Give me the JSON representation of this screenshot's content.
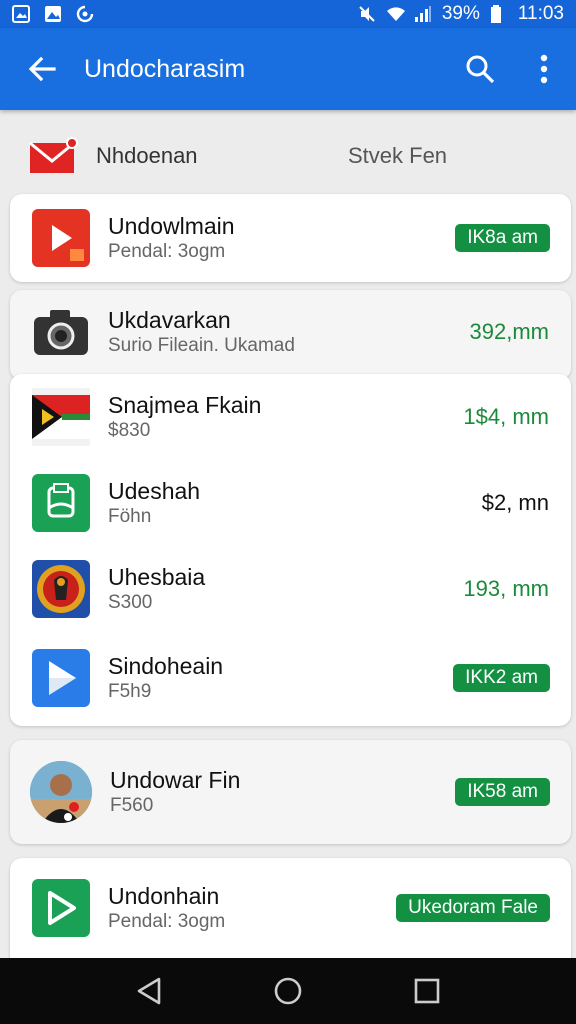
{
  "status_bar": {
    "battery": "39%",
    "time": "11:03"
  },
  "app_bar": {
    "title": "Undocharasim"
  },
  "header": {
    "name": "Nhdoenan",
    "right": "Stvek Fen"
  },
  "items": [
    {
      "name": "Undowlmain",
      "sub": "Pendal: 3ogm",
      "price": "IK8a am",
      "price_style": "badge",
      "icon": "youtube-icon"
    },
    {
      "name": "Ukdavarkan",
      "sub": "Surio Fileain. Ukamad",
      "price": "392,mm",
      "price_style": "green",
      "icon": "camera-icon"
    },
    {
      "name": "Snajmea Fkain",
      "sub": "$830",
      "price": "1$4, mm",
      "price_style": "green",
      "icon": "flag-icon"
    },
    {
      "name": "Udeshah",
      "sub": "Föhn",
      "price": "$2, mn",
      "price_style": "black",
      "icon": "shield-app-icon"
    },
    {
      "name": "Uhesbaia",
      "sub": "S300",
      "price": "193, mm",
      "price_style": "green",
      "icon": "emblem-icon"
    },
    {
      "name": "Sindoheain",
      "sub": "F5h9",
      "price": "IKK2 am",
      "price_style": "badge",
      "icon": "play-store-icon"
    },
    {
      "name": "Undowar Fin",
      "sub": "F560",
      "price": "IK58 am",
      "price_style": "badge",
      "icon": "avatar-icon"
    },
    {
      "name": "Undonhain",
      "sub": "Pendal: 3ogm",
      "price": "Ukedoram Fale",
      "price_style": "badge",
      "icon": "play-icon"
    }
  ],
  "colors": {
    "app_bar": "#1a6fe0",
    "status_bar": "#1565d8",
    "accent_green": "#149043",
    "nav_bar": "#0a0a0a"
  }
}
